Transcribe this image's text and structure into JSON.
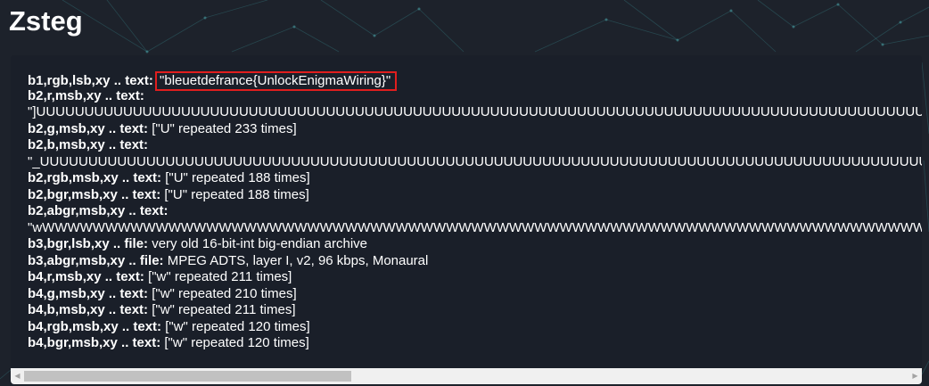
{
  "page": {
    "title": "Zsteg"
  },
  "theme": {
    "background": "#1d222b",
    "panel": "#1a1f29",
    "text": "#ffffff",
    "highlight_border": "#e01e1e",
    "network_lines": "#3a8a8f"
  },
  "icons": {
    "scroll_left": "triangle-left-icon",
    "scroll_right": "triangle-right-icon"
  },
  "results": [
    {
      "key": "b1,rgb,lsb,xy .. text:",
      "value": "\"bleuetdefrance{UnlockEnigmaWiring}\"",
      "highlighted": true
    },
    {
      "key": "b2,r,msb,xy .. text:",
      "value": ""
    },
    {
      "key": "",
      "value": "\"]UUUUUUUUUUUUUUUUUUUUUUUUUUUUUUUUUUUUUUUUUUUUUUUUUUUUUUUUUUUUUUUUUUUUUUUUUUUUUUUUUUUUUUUUUUUUUUUUUUUU"
    },
    {
      "key": "b2,g,msb,xy .. text:",
      "value": "[\"U\" repeated 233 times]"
    },
    {
      "key": "b2,b,msb,xy .. text:",
      "value": ""
    },
    {
      "key": "",
      "value": "\"_UUUUUUUUUUUUUUUUUUUUUUUUUUUUUUUUUUUUUUUUUUUUUUUUUUUUUUUUUUUUUUUUUUUUUUUUUUUUUUUUUUUUUUUUUUUUUUUUUUUU"
    },
    {
      "key": "b2,rgb,msb,xy .. text:",
      "value": "[\"U\" repeated 188 times]"
    },
    {
      "key": "b2,bgr,msb,xy .. text:",
      "value": "[\"U\" repeated 188 times]"
    },
    {
      "key": "b2,abgr,msb,xy .. text:",
      "value": ""
    },
    {
      "key": "",
      "value": "\"wWWWWWWWWWWWWWWWWWWWWWWWWWWWWWWWWWWWWWWWWWWWWWWWWWWWWWWWWWWWWWWWWWWWWWWWWWWWWWWWWWWWWWWWWWWWWWWWWWW"
    },
    {
      "key": "b3,bgr,lsb,xy .. file:",
      "value": "very old 16-bit-int big-endian archive"
    },
    {
      "key": "b3,abgr,msb,xy .. file:",
      "value": "MPEG ADTS, layer I, v2, 96 kbps, Monaural"
    },
    {
      "key": "b4,r,msb,xy .. text:",
      "value": "[\"w\" repeated 211 times]"
    },
    {
      "key": "b4,g,msb,xy .. text:",
      "value": "[\"w\" repeated 210 times]"
    },
    {
      "key": "b4,b,msb,xy .. text:",
      "value": "[\"w\" repeated 211 times]"
    },
    {
      "key": "b4,rgb,msb,xy .. text:",
      "value": "[\"w\" repeated 120 times]"
    },
    {
      "key": "b4,bgr,msb,xy .. text:",
      "value": "[\"w\" repeated 120 times]"
    }
  ],
  "scrollbar": {
    "position_fraction": 0.0,
    "visible_fraction": 0.37
  }
}
